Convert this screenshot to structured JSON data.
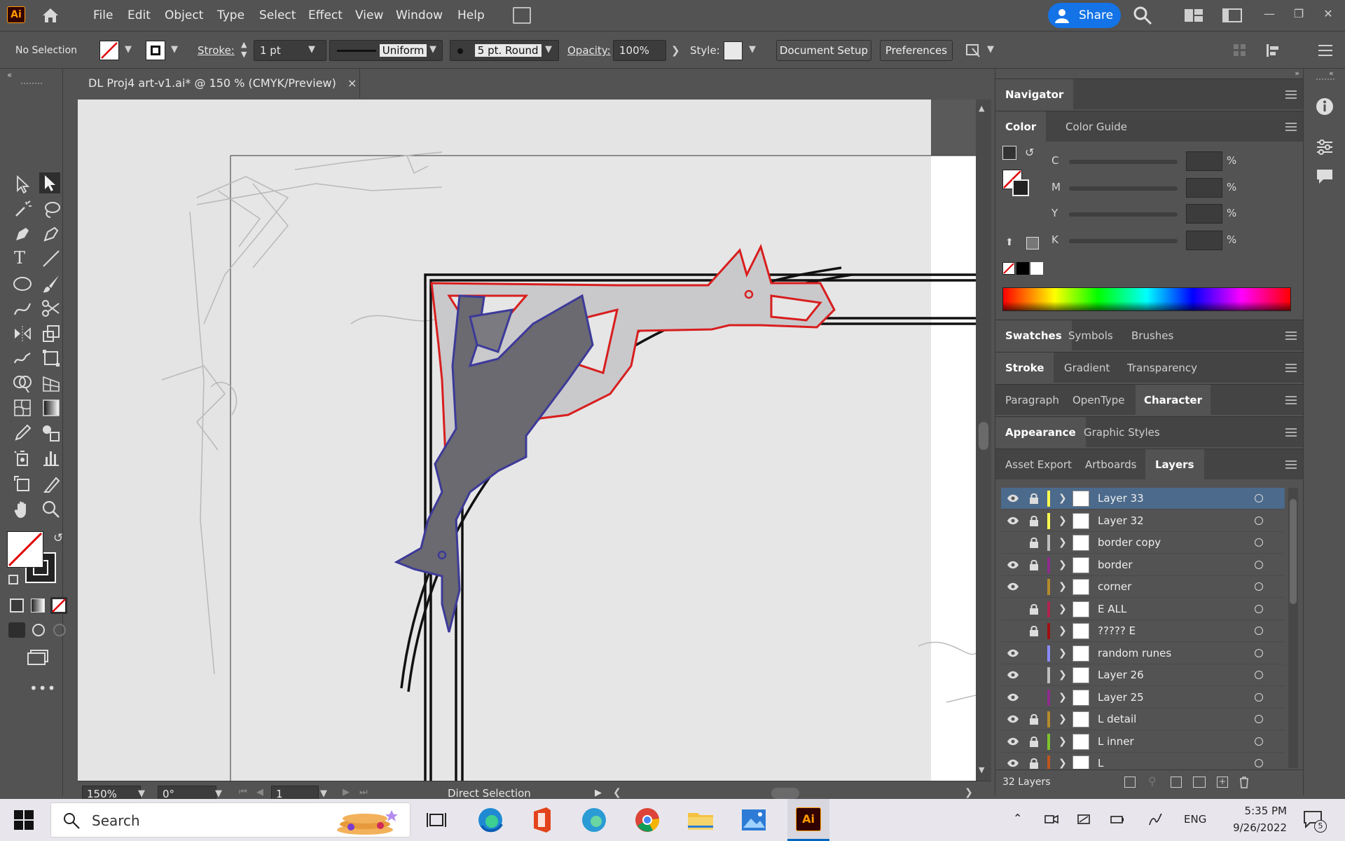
{
  "app": {
    "logo_text": "Ai",
    "logo_color": "#ff9a00"
  },
  "menu": {
    "items": [
      "File",
      "Edit",
      "Object",
      "Type",
      "Select",
      "Effect",
      "View",
      "Window",
      "Help"
    ],
    "share_label": "Share",
    "accent": "#1473e6"
  },
  "control_bar": {
    "selection": "No Selection",
    "stroke_label": "Stroke:",
    "stroke_weight": "1 pt",
    "profile": "Uniform",
    "brush": "5 pt. Round",
    "opacity_label": "Opacity:",
    "opacity_value": "100%",
    "style_label": "Style:",
    "document_setup": "Document Setup",
    "preferences": "Preferences"
  },
  "document": {
    "tab_title": "DL Proj4 art-v1.ai* @ 150 % (CMYK/Preview)",
    "close_glyph": "×"
  },
  "status_bar": {
    "zoom": "150%",
    "rotation": "0°",
    "artboard": "1",
    "tool": "Direct Selection"
  },
  "panels": {
    "navigator": "Navigator",
    "color_tabs": [
      "Color",
      "Color Guide"
    ],
    "cmyk": [
      {
        "label": "C",
        "value": "",
        "unit": "%"
      },
      {
        "label": "M",
        "value": "",
        "unit": "%"
      },
      {
        "label": "Y",
        "value": "",
        "unit": "%"
      },
      {
        "label": "K",
        "value": "",
        "unit": "%"
      }
    ],
    "swatch_tabs": [
      "Swatches",
      "Symbols",
      "Brushes"
    ],
    "stroke_tabs": [
      "Stroke",
      "Gradient",
      "Transparency"
    ],
    "character_tabs": [
      "Paragraph",
      "OpenType",
      "Character"
    ],
    "appearance_tabs": [
      "Appearance",
      "Graphic Styles"
    ],
    "layer_tabs": [
      "Asset Export",
      "Artboards",
      "Layers"
    ],
    "layer_count": "32 Layers"
  },
  "layers": [
    {
      "name": "Layer 33",
      "visible": true,
      "locked": true,
      "color": "#ffff4f",
      "selected": true
    },
    {
      "name": "Layer 32",
      "visible": true,
      "locked": true,
      "color": "#ffff4f",
      "selected": false
    },
    {
      "name": "border copy",
      "visible": false,
      "locked": true,
      "color": "#bfbfbf",
      "selected": false
    },
    {
      "name": "border",
      "visible": true,
      "locked": true,
      "color": "#8e2c8e",
      "selected": false
    },
    {
      "name": "corner",
      "visible": true,
      "locked": false,
      "color": "#b58a2b",
      "selected": false
    },
    {
      "name": "E ALL",
      "visible": false,
      "locked": true,
      "color": "#b0234f",
      "selected": false
    },
    {
      "name": "????? E",
      "visible": false,
      "locked": true,
      "color": "#a01010",
      "selected": false
    },
    {
      "name": "random runes",
      "visible": true,
      "locked": false,
      "color": "#8a8aff",
      "selected": false
    },
    {
      "name": "Layer 26",
      "visible": true,
      "locked": false,
      "color": "#bfbfbf",
      "selected": false
    },
    {
      "name": "Layer 25",
      "visible": true,
      "locked": false,
      "color": "#8e2c8e",
      "selected": false
    },
    {
      "name": "L detail",
      "visible": true,
      "locked": true,
      "color": "#b58a2b",
      "selected": false
    },
    {
      "name": "L inner",
      "visible": true,
      "locked": true,
      "color": "#7ec42c",
      "selected": false
    },
    {
      "name": "L",
      "visible": true,
      "locked": true,
      "color": "#c0561e",
      "selected": false
    }
  ],
  "taskbar": {
    "search_placeholder": "Search",
    "language": "ENG",
    "time": "5:35 PM",
    "date": "9/26/2022",
    "notification_count": "5",
    "ai_label": "Ai"
  }
}
